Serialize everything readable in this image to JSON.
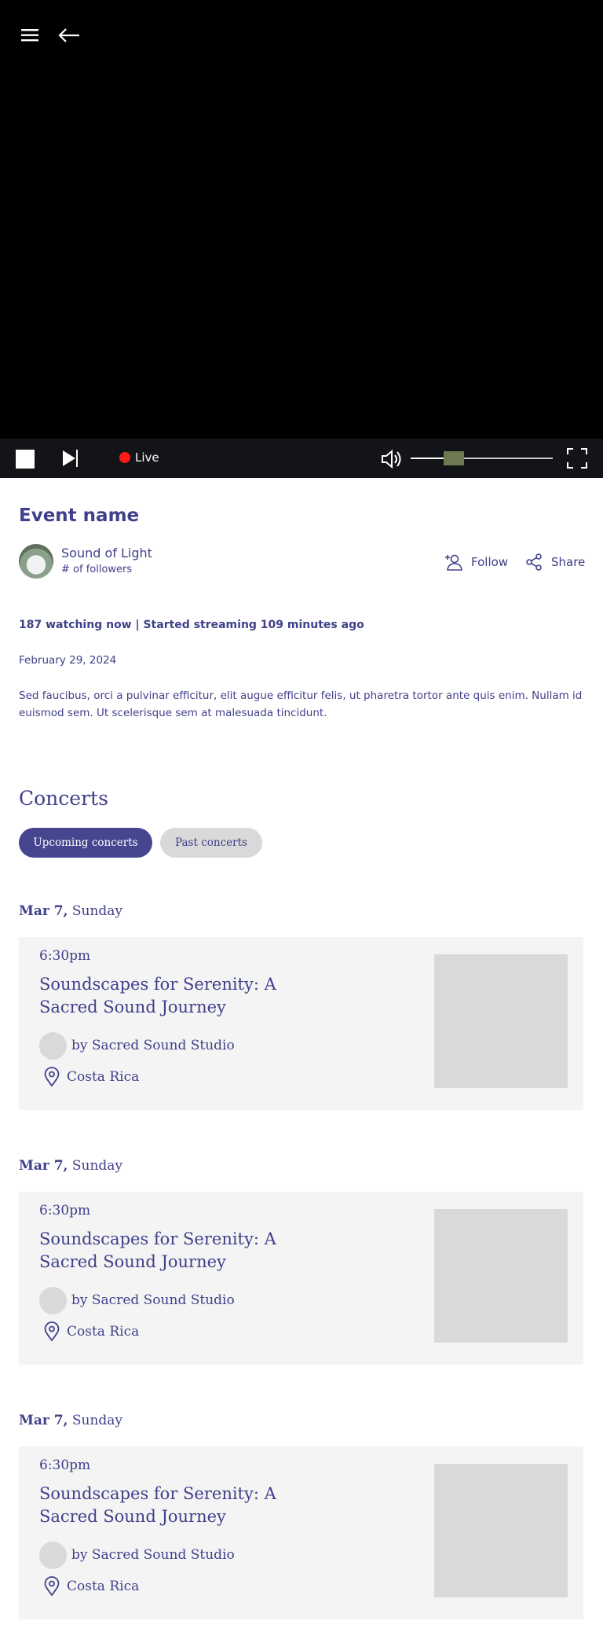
{
  "player": {
    "status_label": "Live",
    "volume_level": 0.3
  },
  "event": {
    "title": "Event name",
    "artist_name": "Sound of Light",
    "followers": "# of followers",
    "follow_label": "Follow",
    "share_label": "Share",
    "watching": "187 watching now | Started streaming 109 minutes ago",
    "date": "February 29, 2024",
    "description": "Sed faucibus, orci a pulvinar efficitur, elit augue efficitur felis, ut pharetra tortor ante quis enim. Nullam id euismod sem. Ut scelerisque sem at malesuada tincidunt."
  },
  "concerts": {
    "heading": "Concerts",
    "tabs": [
      {
        "label": "Upcoming concerts",
        "active": true
      },
      {
        "label": "Past concerts",
        "active": false
      }
    ],
    "items": [
      {
        "day_date": "Mar 7,",
        "day_name": "Sunday",
        "time": "6:30pm",
        "title": "Soundscapes for Serenity: A Sacred Sound Journey",
        "organizer": "by Sacred Sound Studio",
        "location": "Costa Rica"
      },
      {
        "day_date": "Mar 7,",
        "day_name": "Sunday",
        "time": "6:30pm",
        "title": "Soundscapes for Serenity: A Sacred Sound Journey",
        "organizer": "by Sacred Sound Studio",
        "location": "Costa Rica"
      },
      {
        "day_date": "Mar 7,",
        "day_name": "Sunday",
        "time": "6:30pm",
        "title": "Soundscapes for Serenity: A Sacred Sound Journey",
        "organizer": "by Sacred Sound Studio",
        "location": "Costa Rica"
      }
    ]
  },
  "colors": {
    "brand": "#40408a",
    "live": "#ff1a1a",
    "card_bg": "#f4f4f4",
    "placeholder": "#d9d9d9"
  },
  "icons": [
    "menu-icon",
    "back-arrow-icon",
    "stop-icon",
    "skip-next-icon",
    "volume-icon",
    "fullscreen-icon",
    "add-user-icon",
    "share-icon",
    "location-pin-icon"
  ]
}
